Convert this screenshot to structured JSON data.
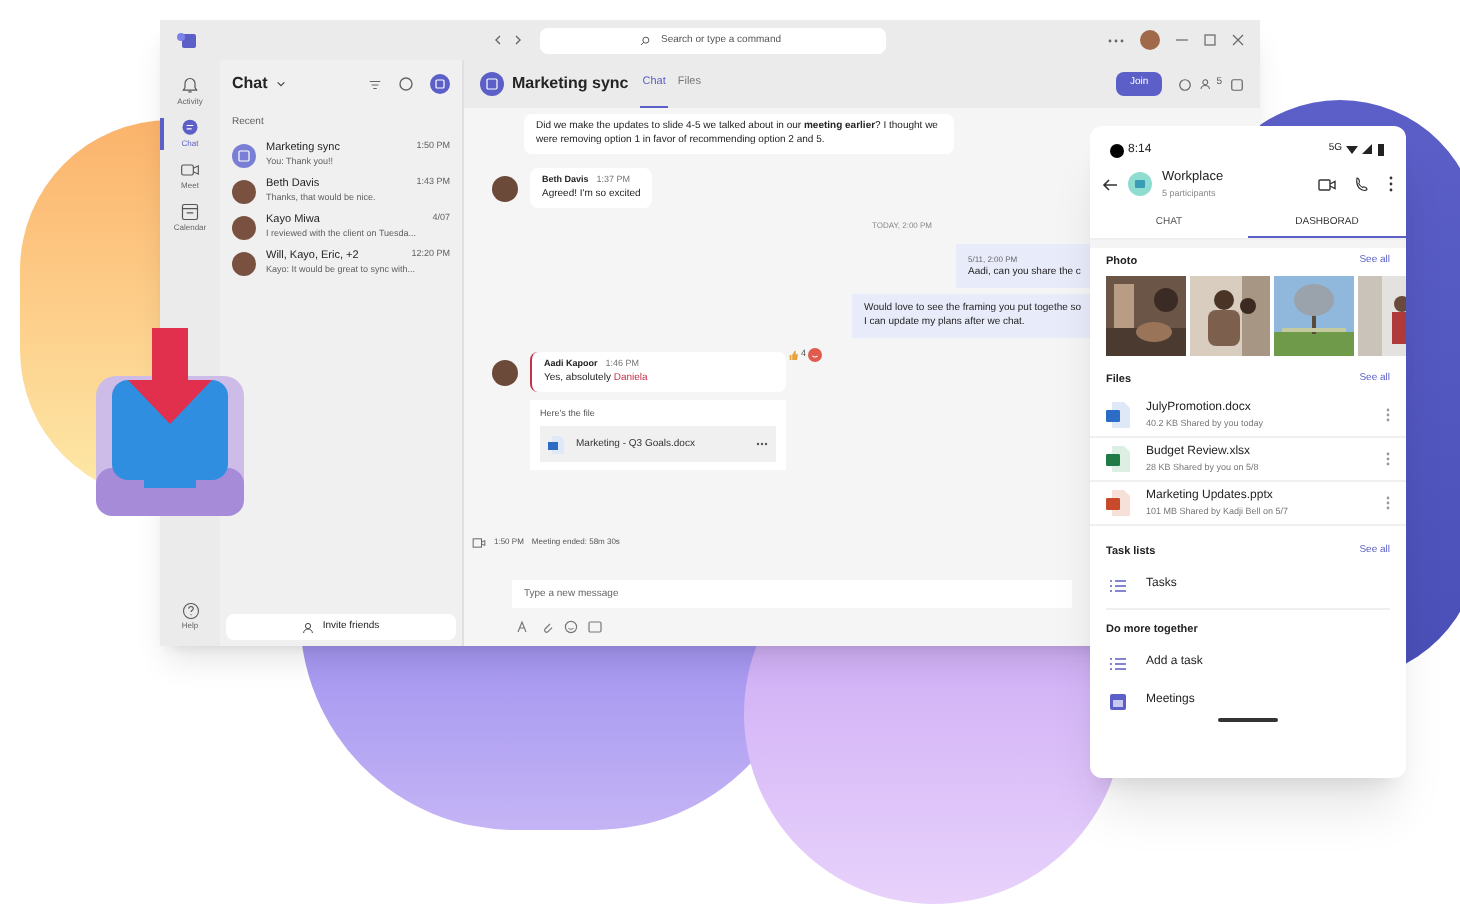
{
  "app": {
    "search_placeholder": "Search or type a command",
    "rail": [
      {
        "kind": "activity",
        "label": "Activity",
        "selected": false
      },
      {
        "kind": "chat",
        "label": "Chat",
        "selected": true
      },
      {
        "kind": "meet",
        "label": "Meet",
        "selected": false
      },
      {
        "kind": "calendar",
        "label": "Calendar",
        "selected": false
      }
    ],
    "help": "Help",
    "chat_list": {
      "title": "Chat",
      "section": "Recent",
      "invite": "Invite friends",
      "items": [
        {
          "kind": "group",
          "name": "Marketing sync",
          "preview": "You: Thank you!!",
          "time": "1:50 PM"
        },
        {
          "kind": "person",
          "name": "Beth Davis",
          "preview": "Thanks, that would be nice.",
          "time": "1:43 PM"
        },
        {
          "kind": "person",
          "name": "Kayo Miwa",
          "preview": "I reviewed with the client on Tuesda...",
          "time": "4/07"
        },
        {
          "kind": "person",
          "name": "Will, Kayo, Eric, +2",
          "preview": "Kayo: It would be great to sync with...",
          "time": "12:20 PM"
        }
      ]
    },
    "conversation": {
      "title": "Marketing sync",
      "tabs": [
        {
          "label": "Chat",
          "selected": true
        },
        {
          "label": "Files",
          "selected": false
        }
      ],
      "join": "Join",
      "participants": "5",
      "messages": [
        {
          "kind": "incoming",
          "text": "Did we make the updates to slide 4-5 we talked about in our **meeting earlier**? I thought we were removing option 1 in favor of recommending option 2 and 5."
        },
        {
          "kind": "incoming",
          "name": "Beth Davis",
          "time": "1:37 PM",
          "text": "Agreed! I'm so excited"
        },
        {
          "kind": "divider",
          "text": "TODAY, 2:00 PM"
        },
        {
          "kind": "outgoing",
          "time": "5/11, 2:00 PM",
          "text": "Aadi, can you share the c"
        },
        {
          "kind": "outgoing",
          "text": "Would love to see the framing you put togethe so I can update my plans after we chat."
        },
        {
          "kind": "incoming",
          "name": "Aadi Kapoor",
          "time": "1:46 PM",
          "text": "Yes, absolutely **Daniela**",
          "reaction": "4",
          "file_intro": "Here's the file",
          "file": "Marketing - Q3 Goals.docx"
        },
        {
          "kind": "event",
          "time": "1:50 PM",
          "text": "Meeting ended: 58m 30s"
        }
      ],
      "compose_placeholder": "Type a new message"
    }
  },
  "phone": {
    "clock": "8:14",
    "network": "5G",
    "title": "Workplace",
    "subtitle": "5 participants",
    "tabs": [
      {
        "label": "CHAT",
        "selected": false
      },
      {
        "label": "DASHBORAD",
        "selected": true
      }
    ],
    "photo_section": {
      "title": "Photo",
      "see_all": "See all"
    },
    "files_section": {
      "title": "Files",
      "see_all": "See all",
      "files": [
        {
          "kind": "word",
          "name": "JulyPromotion.docx",
          "detail": "40.2 KB Shared by you today"
        },
        {
          "kind": "excel",
          "name": "Budget Review.xlsx",
          "detail": "28 KB Shared by you on 5/8"
        },
        {
          "kind": "powerpoint",
          "name": "Marketing Updates.pptx",
          "detail": "101 MB Shared by Kadji Bell on 5/7"
        }
      ]
    },
    "tasks_section": {
      "title": "Task lists",
      "see_all": "See all",
      "items": [
        {
          "kind": "list",
          "label": "Tasks"
        }
      ]
    },
    "more_section": {
      "title": "Do more together",
      "items": [
        {
          "kind": "list",
          "label": "Add a task"
        },
        {
          "kind": "calendar",
          "label": "Meetings"
        }
      ]
    }
  }
}
